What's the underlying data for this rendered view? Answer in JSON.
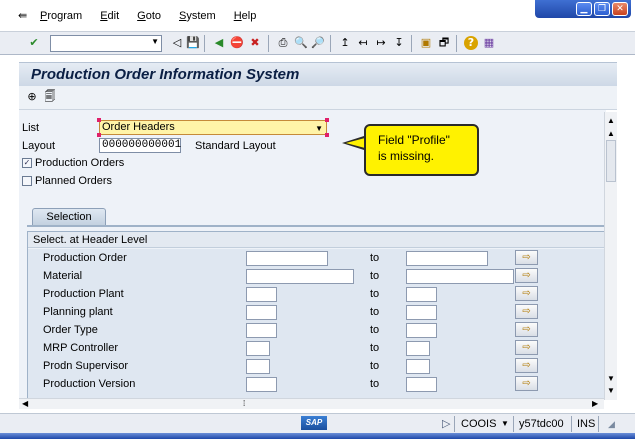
{
  "window": {
    "minimize_glyph": "▁",
    "restore_glyph": "❐",
    "close_glyph": "✕"
  },
  "menu": {
    "app_icon": "⇚",
    "items": [
      {
        "label": "Program"
      },
      {
        "label": "Edit"
      },
      {
        "label": "Goto"
      },
      {
        "label": "System"
      },
      {
        "label": "Help"
      }
    ]
  },
  "toolbar": {
    "enter_icon": "✔",
    "command_value": "",
    "dropdown_glyph": "▼",
    "icons": [
      "◁",
      "💾",
      "◀",
      "⛔",
      "✖",
      "⎙",
      "🔍",
      "🔎",
      "↥",
      "↤",
      "↦",
      "↧",
      "▣",
      "🗗",
      "?",
      "▦"
    ]
  },
  "title": {
    "text": "Production Order Information System"
  },
  "appbar": {
    "icons": [
      "⊕",
      "🗐"
    ]
  },
  "form": {
    "list_label": "List",
    "list_value": "Order Headers",
    "layout_label": "Layout",
    "layout_value": "000000000001",
    "layout_description": "Standard Layout",
    "production_orders_label": "Production Orders",
    "production_orders_checked": true,
    "planned_orders_label": "Planned Orders",
    "planned_orders_checked": false
  },
  "callout": {
    "line1": "Field \"Profile\"",
    "line2": "is missing."
  },
  "tab": {
    "label": "Selection"
  },
  "group": {
    "title": "Select. at Header Level",
    "to_label": "to",
    "more_glyph": "⇨",
    "rows": [
      {
        "label": "Production Order",
        "low": "",
        "high": ""
      },
      {
        "label": "Material",
        "low": "",
        "high": ""
      },
      {
        "label": "Production Plant",
        "low": "",
        "high": ""
      },
      {
        "label": "Planning plant",
        "low": "",
        "high": ""
      },
      {
        "label": "Order Type",
        "low": "",
        "high": ""
      },
      {
        "label": "MRP Controller",
        "low": "",
        "high": ""
      },
      {
        "label": "Prodn Supervisor",
        "low": "",
        "high": ""
      },
      {
        "label": "Production Version",
        "low": "",
        "high": ""
      }
    ]
  },
  "status": {
    "sap_logo": "SAP",
    "play_glyph": "▷",
    "transaction": "COOIS",
    "dd_glyph": "▼",
    "server": "y57tdc00",
    "mode": "INS",
    "resize_glyph": "◢"
  },
  "colors": {
    "accent": "#1f47a8",
    "highlight": "#fff200",
    "selected_field": "#fff4a8"
  }
}
